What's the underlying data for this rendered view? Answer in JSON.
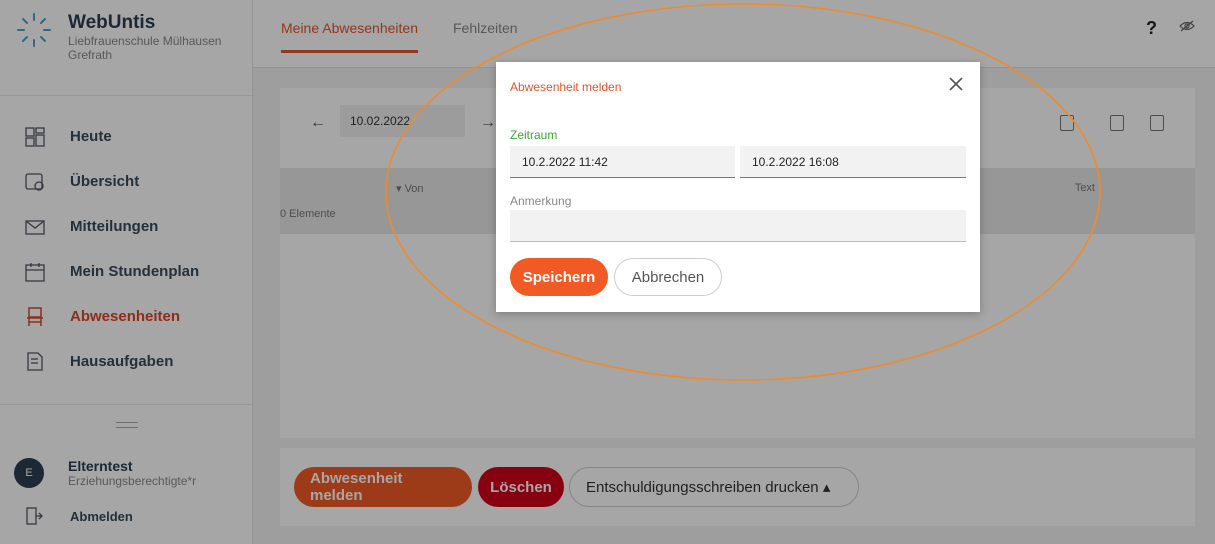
{
  "brand": {
    "title": "WebUntis",
    "school_line1": "Liebfrauenschule Mülhausen",
    "school_line2": "Grefrath"
  },
  "nav": {
    "items": [
      {
        "label": "Heute",
        "icon": "dashboard-icon"
      },
      {
        "label": "Übersicht",
        "icon": "overview-icon"
      },
      {
        "label": "Mitteilungen",
        "icon": "mail-icon"
      },
      {
        "label": "Mein Stundenplan",
        "icon": "calendar-icon"
      },
      {
        "label": "Abwesenheiten",
        "icon": "chair-icon",
        "active": true
      },
      {
        "label": "Hausaufgaben",
        "icon": "homework-icon"
      }
    ]
  },
  "user": {
    "initial": "E",
    "name": "Elterntest",
    "role": "Erziehungsberechtigte*r",
    "logout": "Abmelden"
  },
  "tabs": {
    "active": "Meine Abwesenheiten",
    "other": "Fehlzeiten"
  },
  "header": {
    "help": "?"
  },
  "toolbar": {
    "date": "10.02.2022"
  },
  "table": {
    "col_von": "▾ Von",
    "col_text": "Text",
    "count": "0 Elemente"
  },
  "actions": {
    "report": "Abwesenheit melden",
    "delete": "Löschen",
    "print": "Entschuldigungsschreiben drucken ▴"
  },
  "modal": {
    "title": "Abwesenheit melden",
    "zeitraum_label": "Zeitraum",
    "from": "10.2.2022 11:42",
    "to": "10.2.2022 16:08",
    "note_label": "Anmerkung",
    "note_value": "",
    "save": "Speichern",
    "cancel": "Abbrechen"
  },
  "colors": {
    "accent": "#f15a24",
    "success": "#3ba63b",
    "danger": "#d0021b",
    "annotation": "#f08a2c"
  }
}
